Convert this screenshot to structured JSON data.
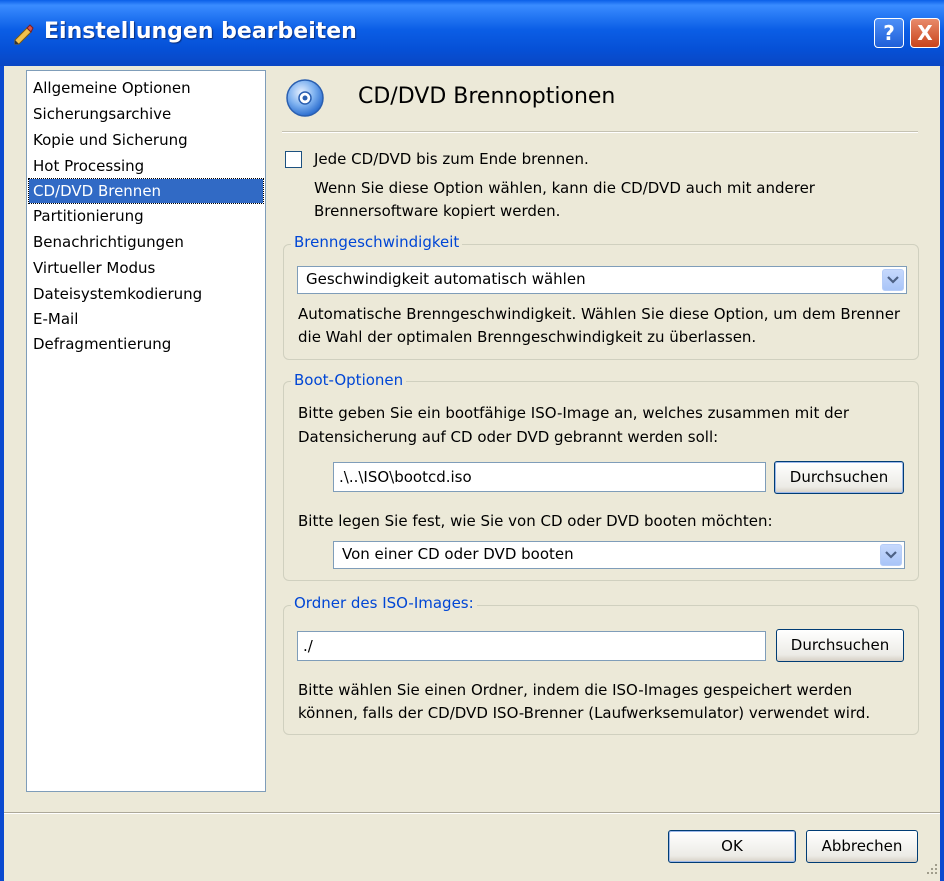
{
  "window": {
    "title": "Einstellungen bearbeiten",
    "help_label": "?",
    "close_label": "X"
  },
  "nav": {
    "items": [
      "Allgemeine Optionen",
      "Sicherungsarchive",
      "Kopie und Sicherung",
      "Hot Processing",
      "CD/DVD Brennen",
      "Partitionierung",
      "Benachrichtigungen",
      "Virtueller Modus",
      "Dateisystemkodierung",
      "E-Mail",
      "Defragmentierung"
    ],
    "selected": "CD/DVD Brennen"
  },
  "header": {
    "title": "CD/DVD Brennoptionen",
    "icon": "cd-icon"
  },
  "finalize": {
    "checkbox_label": "Jede CD/DVD bis zum Ende brennen.",
    "checked": false,
    "desc_line1": "Wenn Sie diese Option wählen, kann die CD/DVD auch mit anderer",
    "desc_line2": "Brennersoftware kopiert werden."
  },
  "speed": {
    "legend": "Brenngeschwindigkeit",
    "selected": "Geschwindigkeit automatisch wählen",
    "desc_line1": "Automatische Brenngeschwindigkeit. Wählen Sie diese Option, um dem Brenner",
    "desc_line2": "die Wahl der optimalen Brenngeschwindigkeit zu überlassen."
  },
  "boot": {
    "legend": "Boot-Optionen",
    "desc_line1": "Bitte geben Sie ein bootfähige ISO-Image an, welches zusammen mit der",
    "desc_line2": "Datensicherung auf CD oder DVD gebrannt werden soll:",
    "path_value": ".\\..\\ISO\\bootcd.iso",
    "browse_label": "Durchsuchen",
    "mode_prompt": "Bitte legen Sie fest, wie Sie von CD oder DVD booten möchten:",
    "mode_selected": "Von einer CD oder DVD booten"
  },
  "iso_folder": {
    "legend": "Ordner des ISO-Images:",
    "path_value": "./",
    "browse_label": "Durchsuchen",
    "desc_line1": "Bitte wählen Sie einen Ordner, indem die ISO-Images gespeichert werden",
    "desc_line2": "können, falls der CD/DVD ISO-Brenner (Laufwerksemulator) verwendet wird."
  },
  "footer": {
    "ok_label": "OK",
    "cancel_label": "Abbrechen"
  },
  "colors": {
    "titlebar": "#0a5fe8",
    "selection": "#316ac5",
    "legend_text": "#0046d5",
    "dialog_bg": "#ece9d8"
  }
}
